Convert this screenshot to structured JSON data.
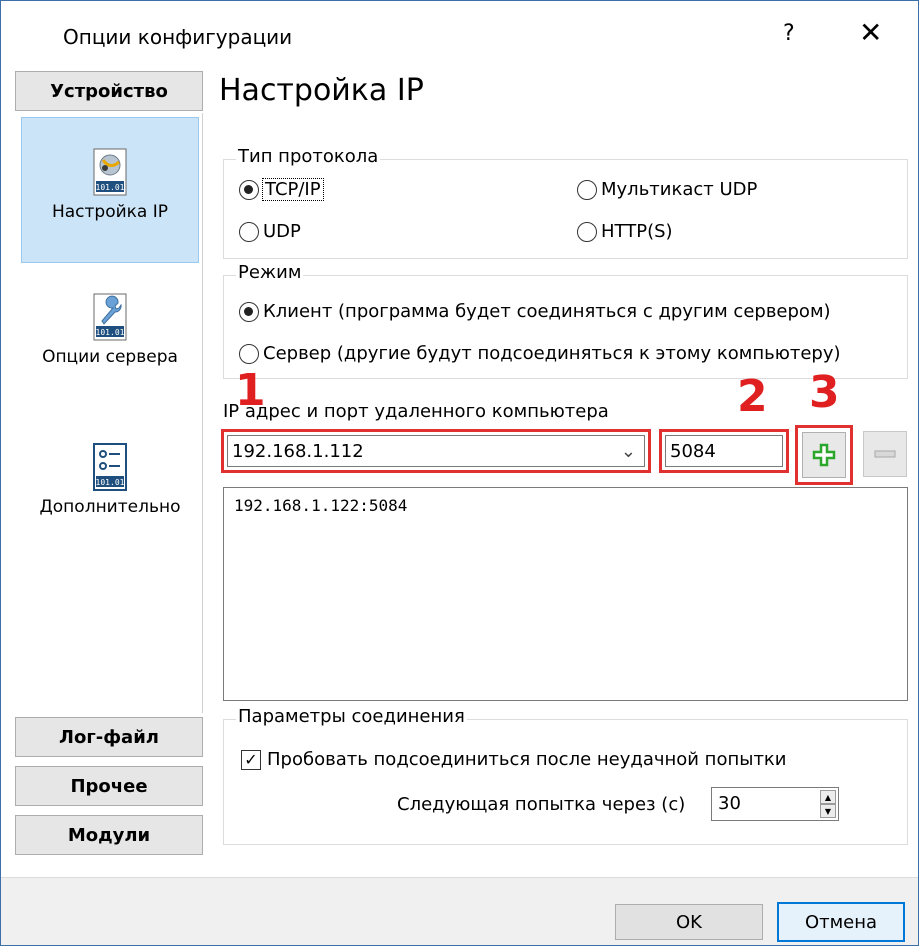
{
  "window": {
    "title": "Опции конфигурации",
    "help": "?",
    "close": "✕"
  },
  "nav": {
    "top_button": "Устройство",
    "items": [
      {
        "label": "Настройка IP",
        "icon": "network-101-icon",
        "selected": true
      },
      {
        "label": "Опции сервера",
        "icon": "wrench-101-icon",
        "selected": false
      },
      {
        "label": "Дополнительно",
        "icon": "options-101-icon",
        "selected": false
      }
    ],
    "icon_caption": "101.01",
    "bottom_buttons": [
      "Лог-файл",
      "Прочее",
      "Модули"
    ]
  },
  "main": {
    "title": "Настройка IP",
    "protocol": {
      "legend": "Тип протокола",
      "options": [
        {
          "label": "TCP/IP",
          "checked": true
        },
        {
          "label": "Мультикаст UDP",
          "checked": false
        },
        {
          "label": "UDP",
          "checked": false
        },
        {
          "label": "HTTP(S)",
          "checked": false
        }
      ]
    },
    "mode": {
      "legend": "Режим",
      "options": [
        {
          "label": "Клиент (программа будет соединяться с другим сервером)",
          "checked": true
        },
        {
          "label": "Сервер (другие будут подсоединяться к этому компьютеру)",
          "checked": false
        }
      ]
    },
    "address": {
      "label": "IP адрес и порт удаленного компьютера",
      "ip_value": "192.168.1.112",
      "port_value": "5084",
      "list": [
        "192.168.1.122:5084"
      ]
    },
    "markers": [
      "1",
      "2",
      "3"
    ],
    "connection": {
      "legend": "Параметры соединения",
      "retry_label": "Пробовать подсоединиться после неудачной попытки",
      "retry_checked": true,
      "next_attempt_label": "Следующая попытка через (с)",
      "next_attempt_value": "30"
    }
  },
  "footer": {
    "ok": "OK",
    "cancel": "Отмена"
  },
  "colors": {
    "accent": "#0078d7",
    "highlight": "#e03030",
    "selection": "#cce4f7",
    "add_icon": "#2da62d"
  }
}
